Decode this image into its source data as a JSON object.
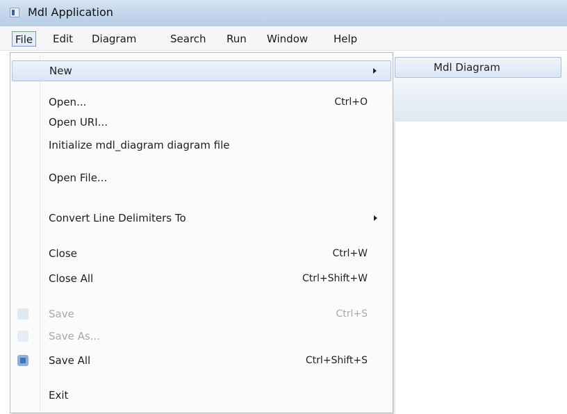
{
  "window": {
    "title": "Mdl Application"
  },
  "menubar": {
    "items": [
      {
        "label": "File"
      },
      {
        "label": "Edit"
      },
      {
        "label": "Diagram"
      },
      {
        "label": "Search"
      },
      {
        "label": "Run"
      },
      {
        "label": "Window"
      },
      {
        "label": "Help"
      }
    ]
  },
  "file_menu": {
    "items": [
      {
        "label": "New",
        "shortcut": ""
      },
      {
        "label": "Open...",
        "shortcut": "Ctrl+O"
      },
      {
        "label": "Open URI...",
        "shortcut": ""
      },
      {
        "label": "Initialize mdl_diagram diagram file",
        "shortcut": ""
      },
      {
        "label": "Open File...",
        "shortcut": ""
      },
      {
        "label": "Convert Line Delimiters To",
        "shortcut": ""
      },
      {
        "label": "Close",
        "shortcut": "Ctrl+W"
      },
      {
        "label": "Close All",
        "shortcut": "Ctrl+Shift+W"
      },
      {
        "label": "Save",
        "shortcut": "Ctrl+S"
      },
      {
        "label": "Save As...",
        "shortcut": ""
      },
      {
        "label": "Save All",
        "shortcut": "Ctrl+Shift+S"
      },
      {
        "label": "Exit",
        "shortcut": ""
      }
    ]
  },
  "new_submenu": {
    "items": [
      {
        "label": "Mdl Diagram"
      }
    ]
  }
}
